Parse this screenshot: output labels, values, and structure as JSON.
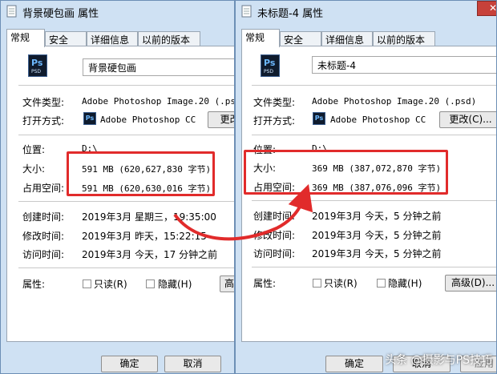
{
  "left_window": {
    "title": "背景硬包画 属性",
    "tabs": [
      "常规",
      "安全",
      "详细信息",
      "以前的版本"
    ],
    "file_name": "背景硬包画",
    "rows": {
      "type_label": "文件类型:",
      "type_value": "Adobe Photoshop Image.20 (.psd)",
      "open_label": "打开方式:",
      "open_value": "Adobe Photoshop CC",
      "change_button": "更改(",
      "location_label": "位置:",
      "location_value": "D:\\",
      "size_label": "大小:",
      "size_value": "591 MB (620,627,830 字节)",
      "disk_label": "占用空间:",
      "disk_value": "591 MB (620,630,016 字节)",
      "created_label": "创建时间:",
      "created_value": "2019年3月 星期三，19:35:00",
      "modified_label": "修改时间:",
      "modified_value": "2019年3月 昨天，15:22:15",
      "accessed_label": "访问时间:",
      "accessed_value": "2019年3月 今天，17 分钟之前",
      "attr_label": "属性:",
      "readonly_label": "只读(R)",
      "hidden_label": "隐藏(H)",
      "advanced_button": "高"
    },
    "ok_button": "确定",
    "cancel_button": "取消"
  },
  "right_window": {
    "title": "未标题-4 属性",
    "close_glyph": "✕",
    "tabs": [
      "常规",
      "安全",
      "详细信息",
      "以前的版本"
    ],
    "file_name": "未标题-4",
    "rows": {
      "type_label": "文件类型:",
      "type_value": "Adobe Photoshop Image.20 (.psd)",
      "open_label": "打开方式:",
      "open_value": "Adobe Photoshop CC",
      "change_button": "更改(C)...",
      "location_label": "位置:",
      "location_value": "D:\\",
      "size_label": "大小:",
      "size_value": "369 MB (387,072,870 字节)",
      "disk_label": "占用空间:",
      "disk_value": "369 MB (387,076,096 字节)",
      "created_label": "创建时间:",
      "created_value": "2019年3月 今天，5 分钟之前",
      "modified_label": "修改时间:",
      "modified_value": "2019年3月 今天，5 分钟之前",
      "accessed_label": "访问时间:",
      "accessed_value": "2019年3月 今天，5 分钟之前",
      "attr_label": "属性:",
      "readonly_label": "只读(R)",
      "hidden_label": "隐藏(H)",
      "advanced_button": "高级(D)..."
    },
    "ok_button": "确定",
    "cancel_button": "取消",
    "apply_button": "应用"
  },
  "icons": {
    "ps_icon_text": "Ps",
    "ps_icon_sub": "PSD"
  },
  "watermark": "头条 @摄影与PS技巧",
  "colors": {
    "highlight": "#e12b2b",
    "window_bg": "#cfe1f3",
    "close_red": "#c7413a"
  }
}
